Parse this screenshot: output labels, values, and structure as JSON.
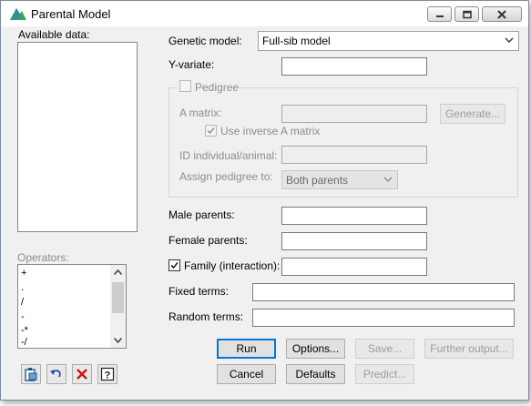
{
  "window": {
    "title": "Parental Model"
  },
  "available_data": {
    "label": "Available data:"
  },
  "operators": {
    "label": "Operators:",
    "items": [
      "+",
      ".",
      "/",
      "-",
      "-*",
      "-/"
    ]
  },
  "genetic_model": {
    "label": "Genetic model:",
    "value": "Full-sib model"
  },
  "y_variate": {
    "label": "Y-variate:",
    "value": ""
  },
  "pedigree": {
    "label": "Pedigree",
    "checked": false,
    "a_matrix_label": "A matrix:",
    "generate_label": "Generate...",
    "use_inverse_label": "Use inverse A matrix",
    "use_inverse_checked": true,
    "id_label": "ID individual/animal:",
    "assign_label": "Assign pedigree to:",
    "assign_value": "Both parents"
  },
  "male_parents": {
    "label": "Male parents:",
    "value": ""
  },
  "female_parents": {
    "label": "Female parents:",
    "value": ""
  },
  "family": {
    "label": "Family (interaction):",
    "checked": true,
    "value": ""
  },
  "fixed_terms": {
    "label": "Fixed terms:",
    "value": ""
  },
  "random_terms": {
    "label": "Random terms:",
    "value": ""
  },
  "buttons": {
    "run": "Run",
    "options": "Options...",
    "save": "Save...",
    "further_output": "Further output...",
    "cancel": "Cancel",
    "defaults": "Defaults",
    "predict": "Predict..."
  },
  "colors": {
    "focus": "#0078d7",
    "disabled_text": "#8c8c8c"
  }
}
